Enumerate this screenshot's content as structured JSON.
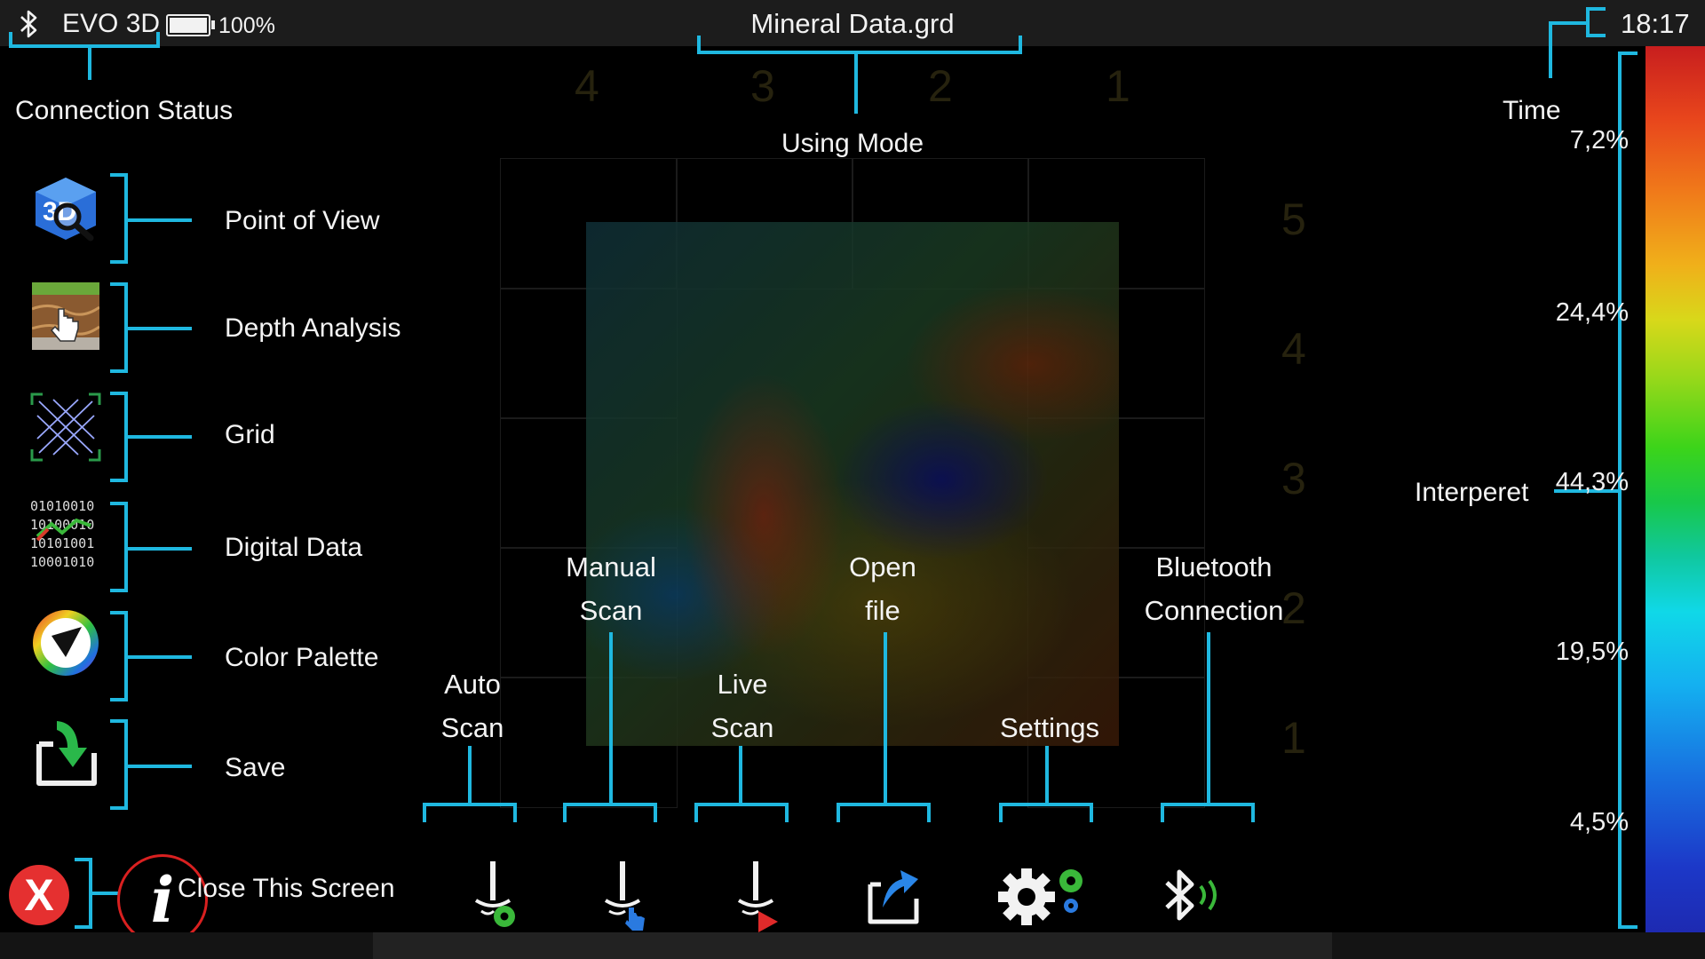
{
  "status_bar": {
    "device_name": "EVO 3D",
    "battery_percent": "100%",
    "battery_level": 1.0,
    "file_name": "Mineral Data.grd",
    "time": "18:17"
  },
  "annotations": {
    "connection_status": "Connection Status",
    "using_mode": "Using Mode",
    "time": "Time",
    "interpret": "Interperet",
    "close_screen": "Close This Screen"
  },
  "sidebar": {
    "items": [
      {
        "label": "Point of View",
        "icon": "3d-view-icon"
      },
      {
        "label": "Depth Analysis",
        "icon": "depth-analysis-icon"
      },
      {
        "label": "Grid",
        "icon": "grid-icon"
      },
      {
        "label": "Digital Data",
        "icon": "digital-data-icon"
      },
      {
        "label": "Color Palette",
        "icon": "color-palette-icon"
      },
      {
        "label": "Save",
        "icon": "save-icon"
      }
    ],
    "digital_data_lines": [
      "01010010",
      "10100010",
      "10101001",
      "10001010"
    ]
  },
  "toolbar": {
    "auto_scan": [
      "Auto",
      "Scan"
    ],
    "manual_scan": [
      "Manual",
      "Scan"
    ],
    "live_scan": [
      "Live",
      "Scan"
    ],
    "open_file": [
      "Open",
      "file"
    ],
    "settings": [
      "Settings"
    ],
    "bluetooth": [
      "Bluetooth",
      "Connection"
    ]
  },
  "grid_axis": {
    "top": [
      "4",
      "3",
      "2",
      "1"
    ],
    "right": [
      "5",
      "4",
      "3",
      "2",
      "1"
    ]
  },
  "color_scale": {
    "labels": [
      "7,2%",
      "24,4%",
      "44,3%",
      "19,5%",
      "4,5%"
    ]
  },
  "colors": {
    "accent": "#1fb8e0",
    "close": "#e53030"
  }
}
